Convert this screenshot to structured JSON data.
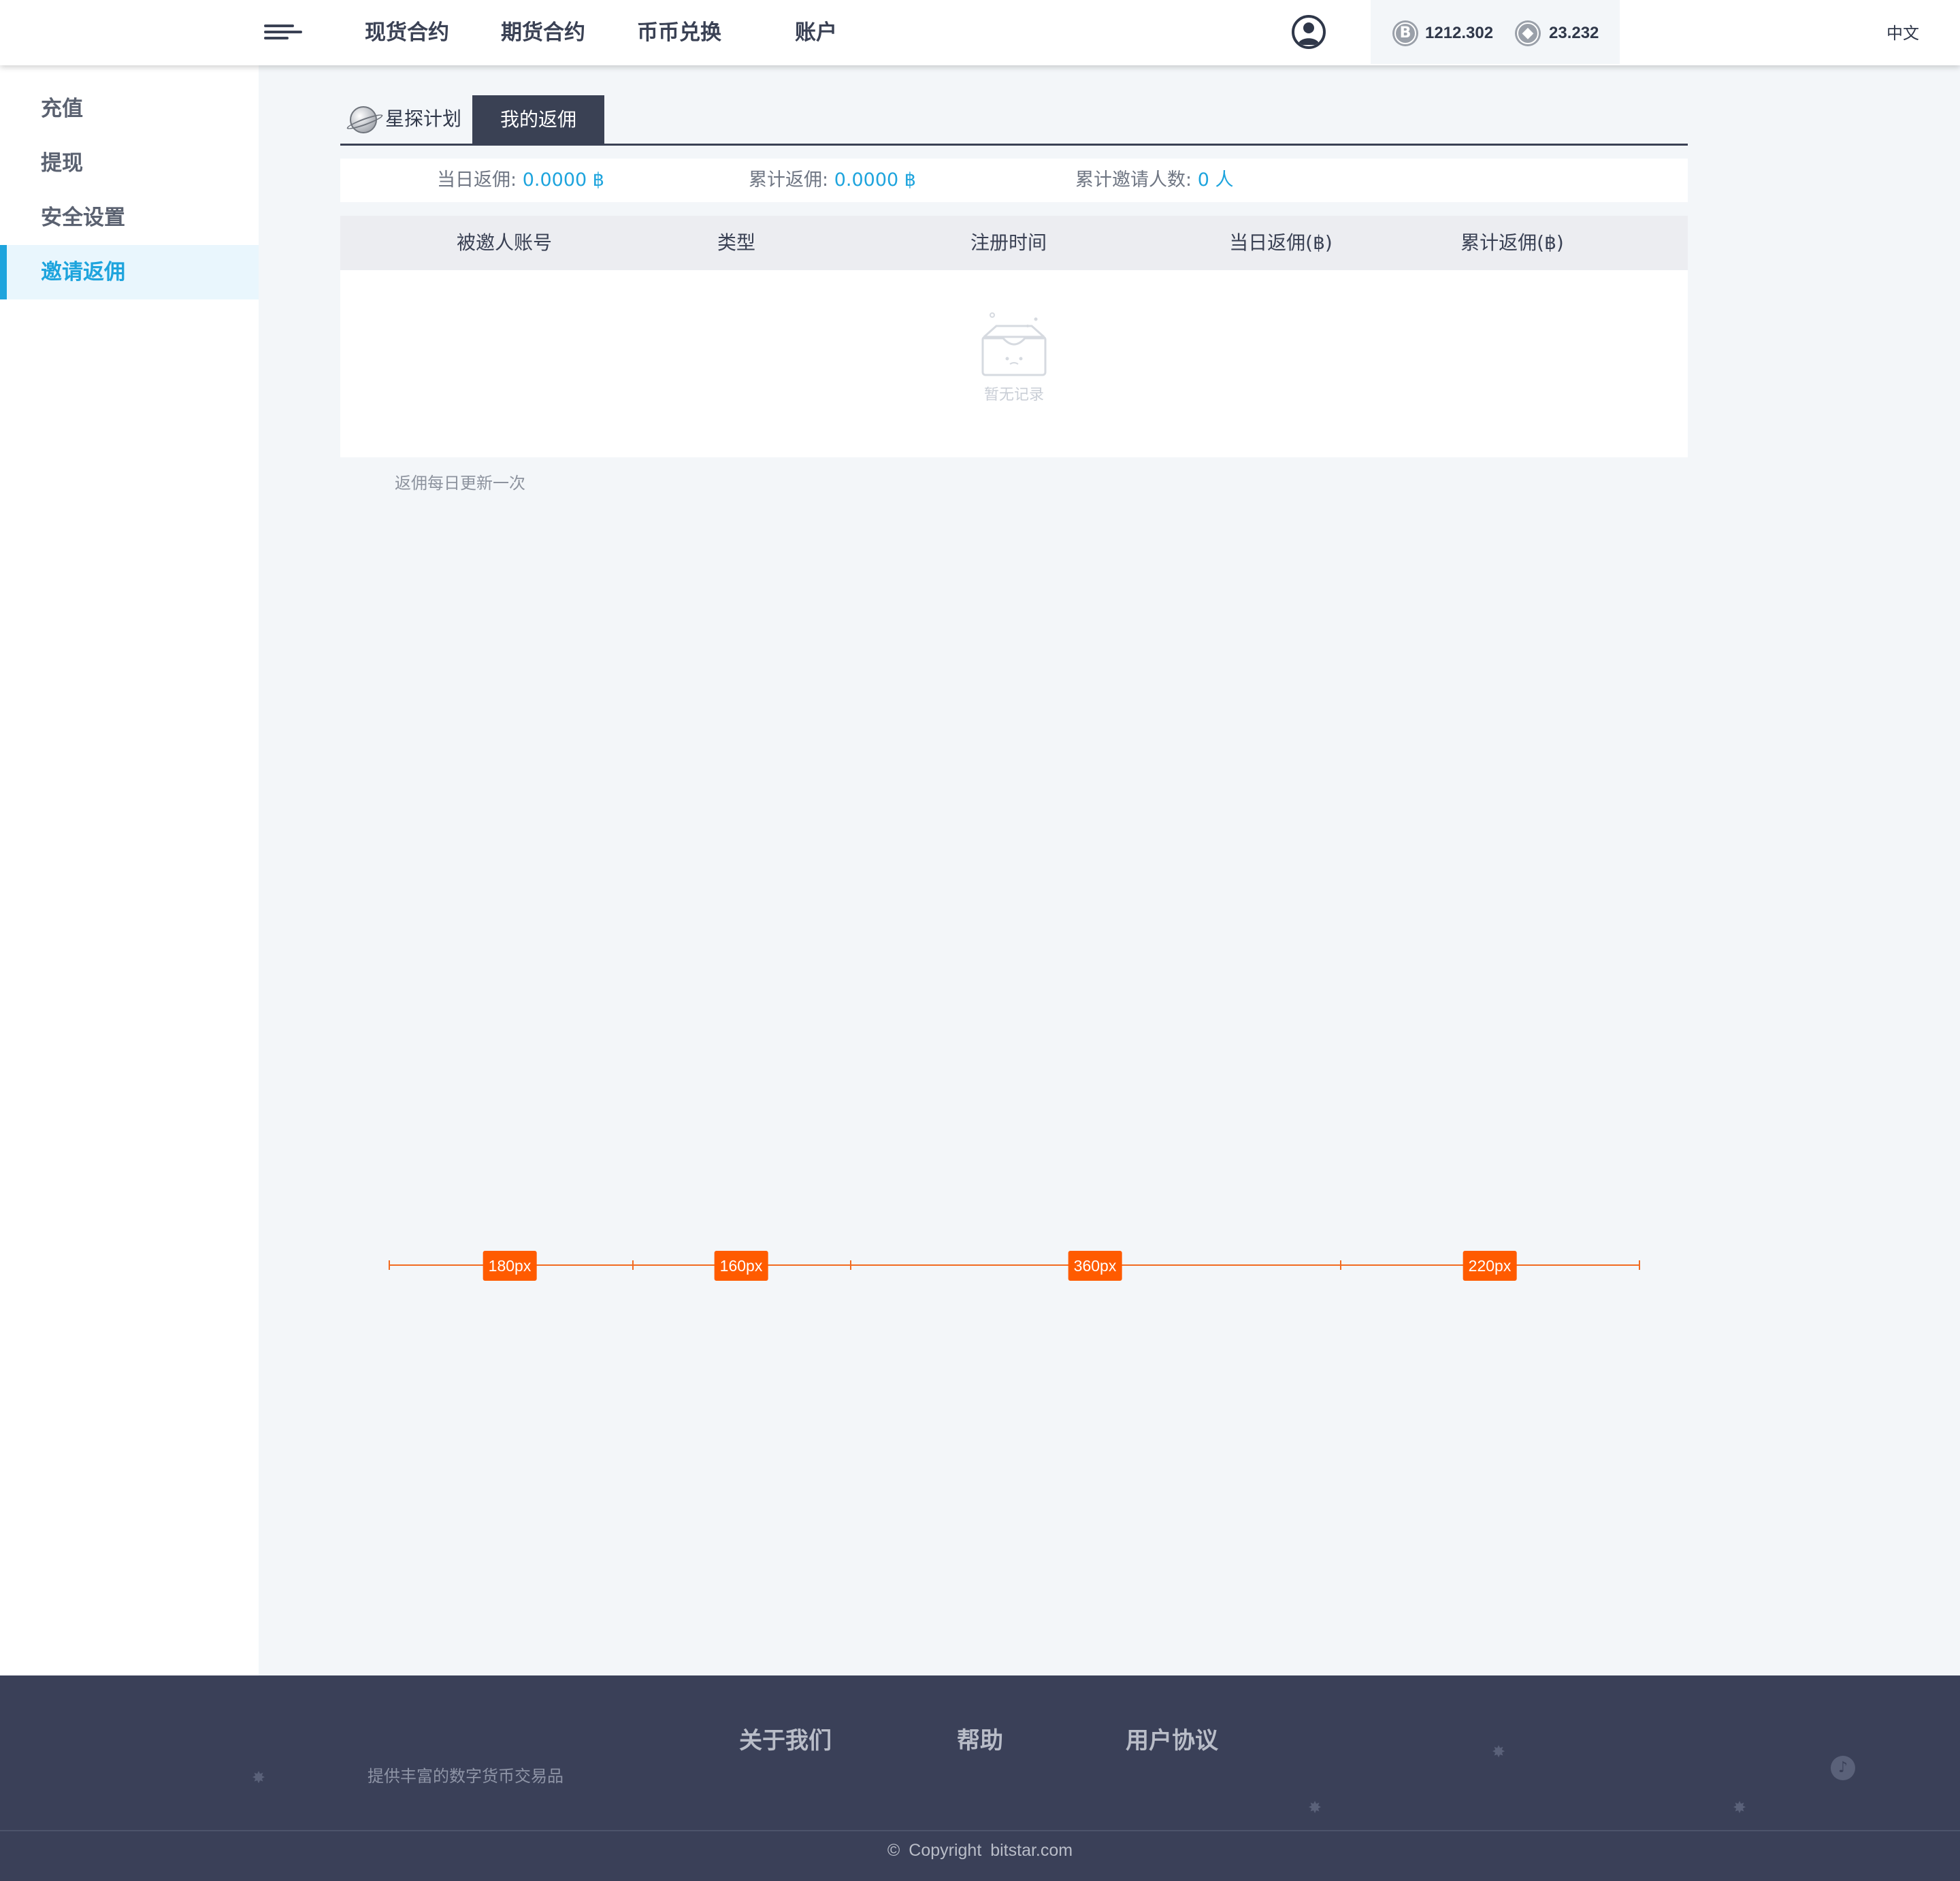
{
  "header": {
    "nav": [
      "现货合约",
      "期货合约",
      "币币兑换",
      "账户"
    ],
    "balances": [
      {
        "icon": "bitcoin-icon",
        "symbol": "B",
        "value": "1212.302"
      },
      {
        "icon": "ethereum-icon",
        "symbol": "◆",
        "value": "23.232"
      }
    ],
    "language": "中文"
  },
  "sidebar": {
    "items": [
      {
        "label": "充值",
        "active": false
      },
      {
        "label": "提现",
        "active": false
      },
      {
        "label": "安全设置",
        "active": false
      },
      {
        "label": "邀请返佣",
        "active": true
      }
    ]
  },
  "tabs": {
    "star_plan": "星探计划",
    "my_rebate": "我的返佣"
  },
  "stats": {
    "today_label": "当日返佣:",
    "today_value": "0.0000 ฿",
    "total_label": "累计返佣:",
    "total_value": "0.0000 ฿",
    "invited_label": "累计邀请人数:",
    "invited_value": "0 人"
  },
  "table": {
    "columns": [
      "被邀人账号",
      "类型",
      "注册时间",
      "当日返佣(฿)",
      "累计返佣(฿)"
    ],
    "rows": [],
    "empty_text": "暂无记录"
  },
  "note": "返佣每日更新一次",
  "ruler": {
    "labels": [
      "180px",
      "160px",
      "360px",
      "220px"
    ]
  },
  "footer": {
    "links": [
      "关于我们",
      "帮助",
      "用户协议"
    ],
    "slogan": "提供丰富的数字货币交易品",
    "copyright": "© Copyright   bitstar.com"
  },
  "colors": {
    "accent": "#1ea4dd",
    "dark": "#3a4154",
    "footer_bg": "#3a4058",
    "ruler": "#ff5b00"
  }
}
